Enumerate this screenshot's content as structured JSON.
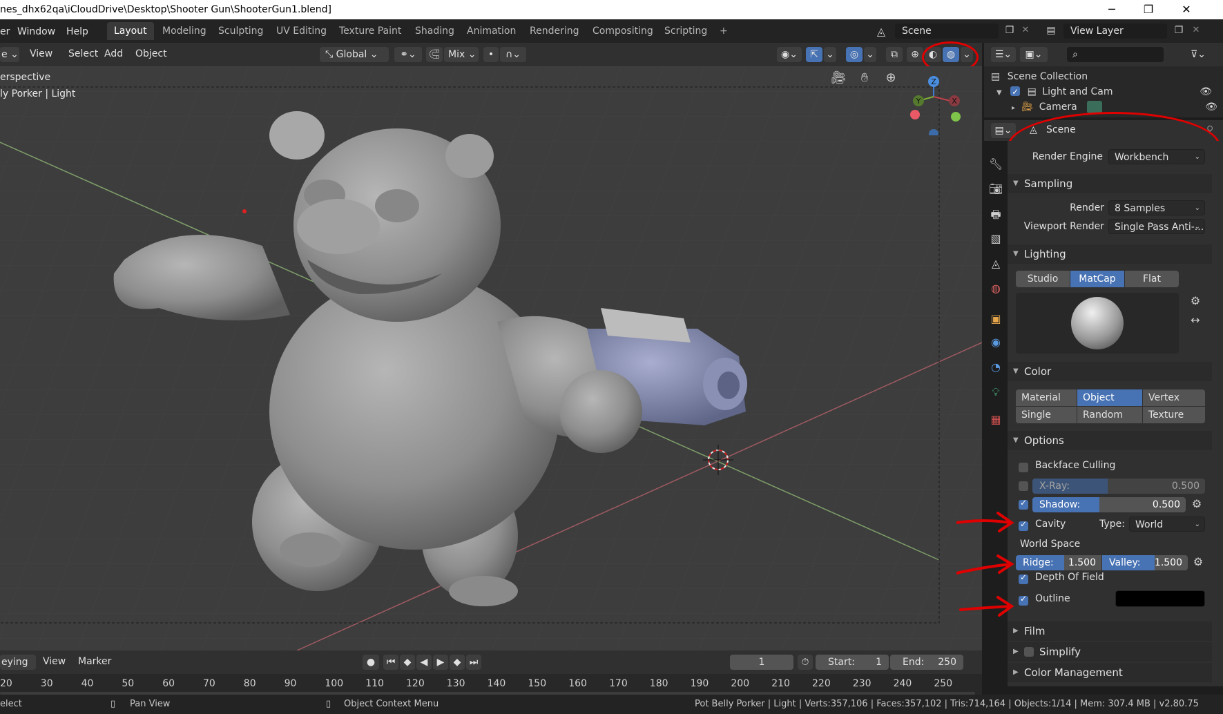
{
  "window": {
    "title": "nes_dhx62qa\\iCloudDrive\\Desktop\\Shooter Gun\\ShooterGun1.blend]",
    "minimize": "─",
    "maximize": "❐",
    "close": "✕"
  },
  "menu": [
    "er",
    "Window",
    "Help"
  ],
  "workspaces": {
    "tabs": [
      "Layout",
      "Modeling",
      "Sculpting",
      "UV Editing",
      "Texture Paint",
      "Shading",
      "Animation",
      "Rendering",
      "Compositing",
      "Scripting"
    ],
    "add": "+"
  },
  "scene_field": "Scene",
  "view_layer_field": "View Layer",
  "viewport_header": {
    "mode": "e",
    "view": "View",
    "select": "Select",
    "add": "Add",
    "object": "Object",
    "orientation": "Global",
    "snap_mode": "Mix"
  },
  "viewport": {
    "overlay_line1": "erspective",
    "overlay_line2": "ly Porker | Light",
    "gizmo": {
      "z": "Z",
      "y": "Y",
      "x": "X"
    }
  },
  "outliner": {
    "search_placeholder": "",
    "items": [
      {
        "label": "Scene Collection"
      },
      {
        "label": "Light and Cam"
      },
      {
        "label": "Camera"
      }
    ]
  },
  "properties": {
    "context": "Scene",
    "render_engine_label": "Render Engine",
    "render_engine": "Workbench",
    "sampling": {
      "title": "Sampling",
      "render_label": "Render",
      "render_value": "8 Samples",
      "viewport_label": "Viewport Render",
      "viewport_value": "Single Pass Anti-..."
    },
    "lighting": {
      "title": "Lighting",
      "options": [
        "Studio",
        "MatCap",
        "Flat"
      ],
      "selected": "MatCap"
    },
    "color": {
      "title": "Color",
      "options": [
        "Material",
        "Object",
        "Vertex",
        "Single",
        "Random",
        "Texture"
      ],
      "selected": "Object"
    },
    "options": {
      "title": "Options",
      "backface": "Backface Culling",
      "xray_label": "X-Ray:",
      "xray_value": "0.500",
      "xray_fraction": 0.5,
      "shadow_label": "Shadow:",
      "shadow_value": "0.500",
      "shadow_fraction": 0.5,
      "cavity": "Cavity",
      "type_label": "Type:",
      "type_value": "World",
      "world_space": "World Space",
      "ridge_label": "Ridge:",
      "ridge_value": "1.500",
      "valley_label": "Valley:",
      "valley_value": "1.500",
      "dof": "Depth Of Field",
      "outline": "Outline"
    },
    "film": "Film",
    "simplify": "Simplify",
    "color_management": "Color Management"
  },
  "timeline": {
    "keying": "eying",
    "view": "View",
    "marker": "Marker",
    "current_frame": "1",
    "start_label": "Start:",
    "start_value": "1",
    "end_label": "End:",
    "end_value": "250",
    "ticks": [
      "20",
      "30",
      "40",
      "50",
      "60",
      "70",
      "80",
      "90",
      "100",
      "110",
      "120",
      "130",
      "140",
      "150",
      "160",
      "170",
      "180",
      "190",
      "200",
      "210",
      "220",
      "230",
      "240",
      "250"
    ]
  },
  "statusbar": {
    "left": "elect",
    "pan": "Pan View",
    "context": "Object Context Menu",
    "stats": "Pot Belly Porker | Light | Verts:357,106 | Faces:357,102 | Tris:714,164 | Objects:1/14 | Mem: 307.4 MB | v2.80.75"
  },
  "colors": {
    "accent": "#4772b3",
    "annotation": "#e00000",
    "model": "#8f8f8f",
    "gun": "#7f86a8"
  }
}
